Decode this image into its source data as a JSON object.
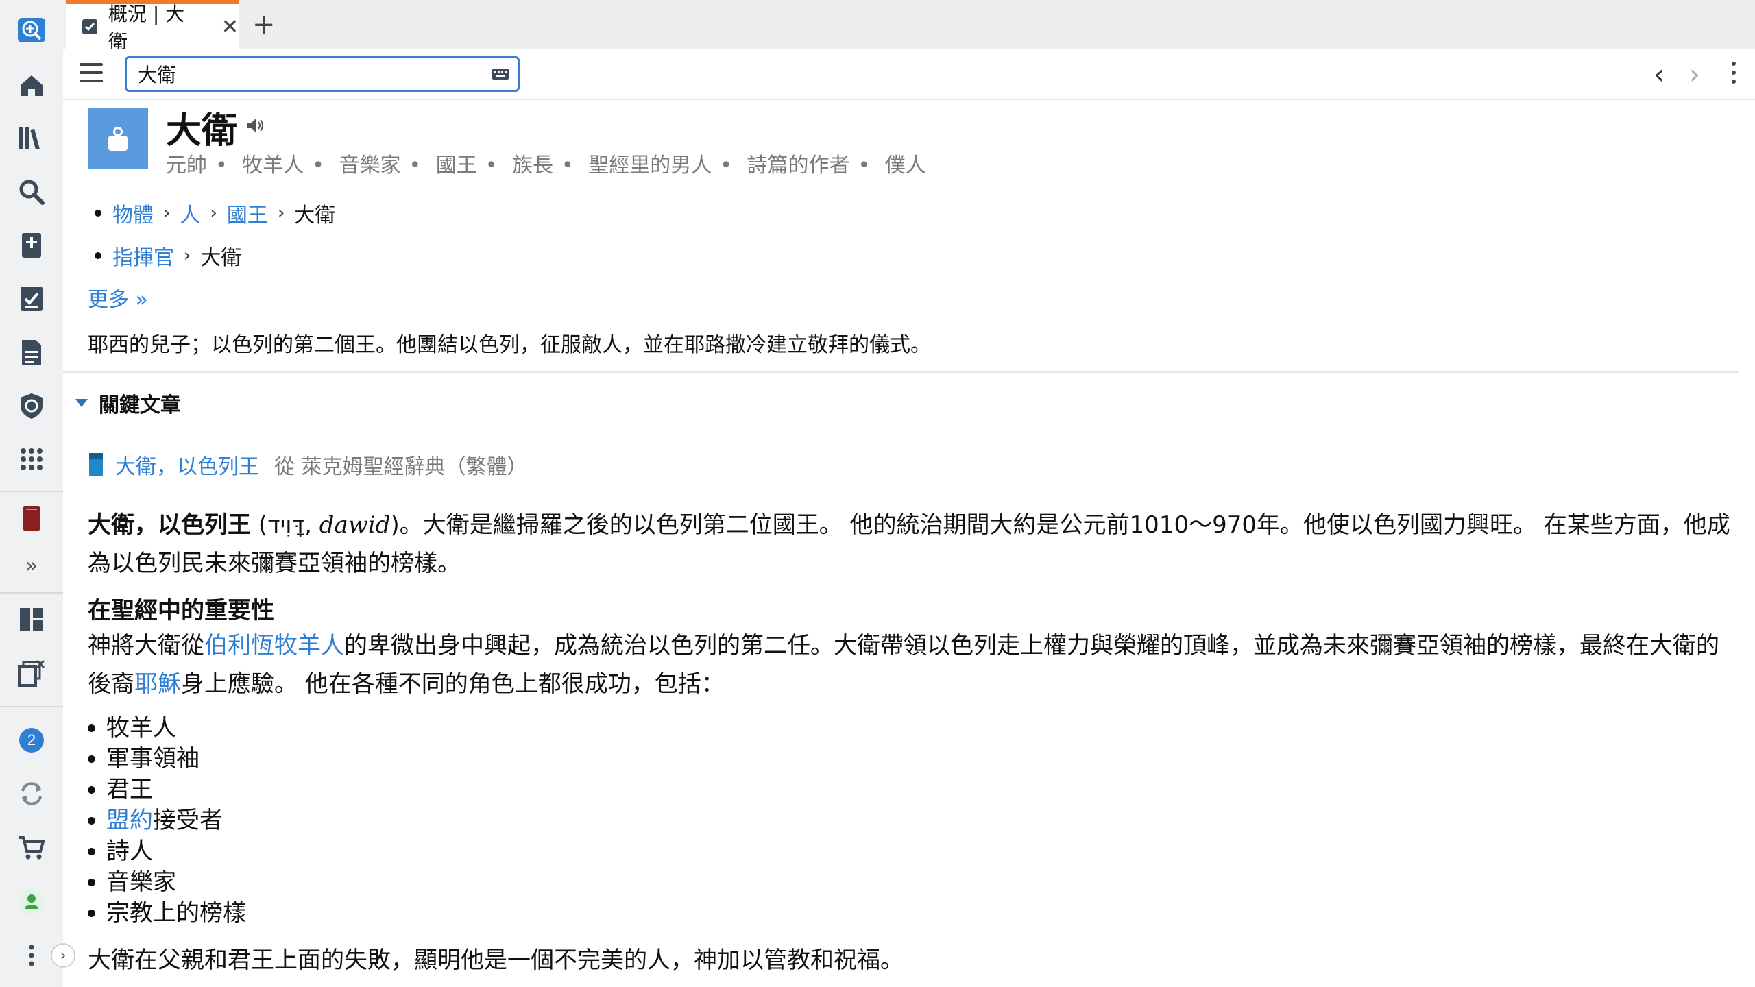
{
  "tab": {
    "title": "概況 | 大衛"
  },
  "search": {
    "value": "大衛"
  },
  "header": {
    "title": "大衛",
    "subtitles": [
      "元帥",
      "牧羊人",
      "音樂家",
      "國王",
      "族長",
      "聖經里的男人",
      "詩篇的作者",
      "僕人"
    ]
  },
  "breadcrumbs": [
    {
      "links": [
        "物體",
        "人",
        "國王"
      ],
      "current": "大衛"
    },
    {
      "links": [
        "指揮官"
      ],
      "current": "大衛"
    }
  ],
  "more_label": "更多 »",
  "description": "耶西的兒子；以色列的第二個王。他團結以色列，征服敵人，並在耶路撒冷建立敬拜的儀式。",
  "section": {
    "title": "關鍵文章"
  },
  "article": {
    "title": "大衛，以色列王",
    "source": "從 萊克姆聖經辭典（繁體）"
  },
  "body": {
    "lead_bold": "大衛，以色列王",
    "lead_hebrew": "(דָּוִיד, ",
    "lead_translit": "dawid",
    "lead_rest": ")。大衛是繼掃羅之後的以色列第二位國王。 他的統治期間大約是公元前1010～970年。他使以色列國力興旺。 在某些方面，他成為以色列民未來彌賽亞領袖的榜樣。",
    "heading": "在聖經中的重要性",
    "p2_a": "神將大衛從",
    "p2_link1": "伯利恆牧羊人",
    "p2_b": "的卑微出身中興起，成為統治以色列的第二任。大衛帶領以色列走上權力與榮耀的頂峰，並成為未來彌賽亞領袖的榜樣，最終在大衛的後裔",
    "p2_link2": "耶穌",
    "p2_c": "身上應驗。 他在各種不同的角色上都很成功，包括：",
    "roles": [
      "牧羊人",
      "軍事領袖",
      "君王",
      "接受者",
      "詩人",
      "音樂家",
      "宗教上的榜樣"
    ],
    "role_link": "盟約",
    "closing": "大衛在父親和君王上面的失敗，顯明他是一個不完美的人，神加以管教和祝福。"
  },
  "sidebar": {
    "notification_count": "2"
  },
  "colors": {
    "accent": "#2f7fd4",
    "tab_indicator": "#f07a2a",
    "avatar_bg": "#5a9be0"
  }
}
